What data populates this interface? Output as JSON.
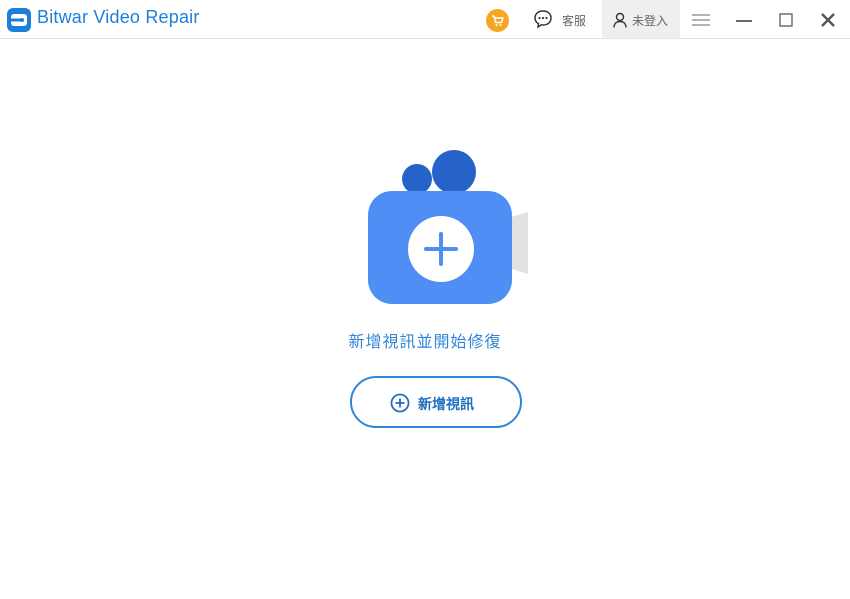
{
  "app": {
    "title": "Bitwar Video Repair",
    "accent_color": "#1e7fd8"
  },
  "toolbar": {
    "cart_icon": "cart-icon",
    "support_label": "客服",
    "support_icon": "chat-bubble-icon",
    "login_label": "未登入",
    "login_icon": "user-icon",
    "menu_icon": "hamburger-icon",
    "minimize_icon": "minimize-icon",
    "maximize_icon": "maximize-icon",
    "close_icon": "close-icon"
  },
  "main": {
    "hero_icon": "video-camera-add-icon",
    "prompt_text": "新增視訊並開始修復",
    "add_button_label": "新增視訊",
    "add_button_icon": "plus-circle-icon"
  },
  "colors": {
    "camera_body": "#4f8ef5",
    "camera_dark": "#2563c8",
    "cart": "#f5a623"
  }
}
